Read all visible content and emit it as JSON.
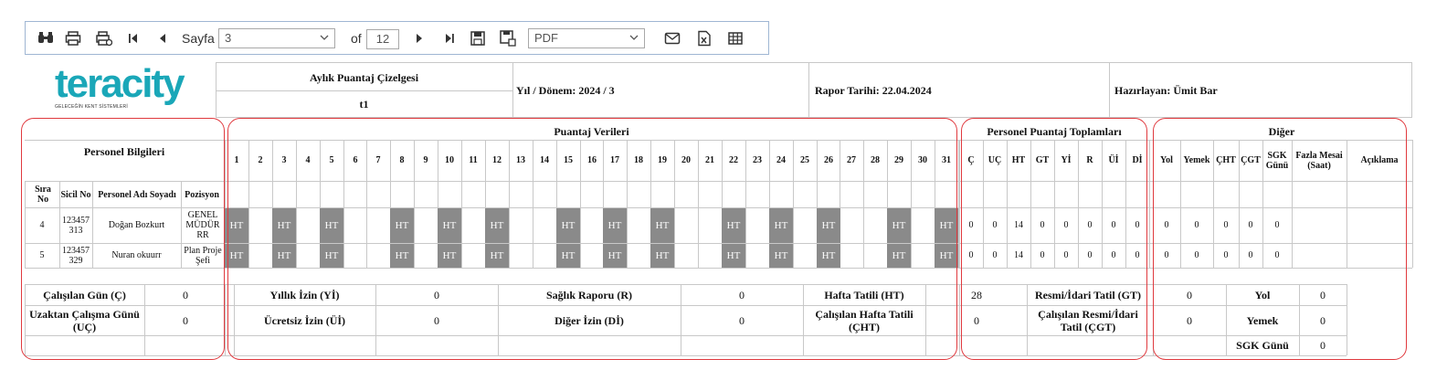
{
  "toolbar": {
    "page_label": "Sayfa",
    "page_value": "3",
    "of_label": "of",
    "page_count": "12",
    "format_value": "PDF"
  },
  "brand": {
    "logo_text": "teracity",
    "logo_subtext": "GELECEĞİN KENT SİSTEMLERİ",
    "color": "#1aa7b8"
  },
  "header": {
    "title": "Aylık Puantaj Çizelgesi",
    "subtitle": "t1",
    "period": "Yıl / Dönem: 2024 / 3",
    "report_date": "Rapor Tarihi: 22.04.2024",
    "prepared_by": "Hazırlayan: Ümit Bar"
  },
  "sections": {
    "personnel": "Personel Bilgileri",
    "attendance": "Puantaj  Verileri",
    "totals": "Personel Puantaj Toplamları",
    "other": "Diğer"
  },
  "personnel_columns": [
    "Sıra No",
    "Sicil No",
    "Personel Adı Soyadı",
    "Pozisyon"
  ],
  "days": [
    "1",
    "2",
    "3",
    "4",
    "5",
    "6",
    "7",
    "8",
    "9",
    "10",
    "11",
    "12",
    "13",
    "14",
    "15",
    "16",
    "17",
    "18",
    "19",
    "20",
    "21",
    "22",
    "23",
    "24",
    "25",
    "26",
    "27",
    "28",
    "29",
    "30",
    "31"
  ],
  "total_columns": [
    "Ç",
    "UÇ",
    "HT",
    "GT",
    "Yİ",
    "R",
    "Üİ",
    "Dİ"
  ],
  "other_columns": [
    "Yol",
    "Yemek",
    "ÇHT",
    "ÇGT",
    "SGK Günü",
    "Fazla Mesai (Saat)",
    "Açıklama"
  ],
  "rows": [
    {
      "sira": "4",
      "sicil": "123457 313",
      "name": "Doğan Bozkurt",
      "position": "GENEL MÜDÜR RR",
      "ht_days": [
        "1",
        "3",
        "5",
        "8",
        "10",
        "12",
        "15",
        "17",
        "19",
        "22",
        "24",
        "26",
        "29",
        "31"
      ],
      "totals": [
        "0",
        "0",
        "14",
        "0",
        "0",
        "0",
        "0",
        "0"
      ],
      "other": [
        "0",
        "0",
        "0",
        "0",
        "0",
        "",
        ""
      ]
    },
    {
      "sira": "5",
      "sicil": "123457 329",
      "name": "Nuran okuurr",
      "position": "Plan Proje Şefi",
      "ht_days": [
        "1",
        "3",
        "5",
        "8",
        "10",
        "12",
        "15",
        "17",
        "19",
        "22",
        "24",
        "26",
        "29",
        "31"
      ],
      "totals": [
        "0",
        "0",
        "14",
        "0",
        "0",
        "0",
        "0",
        "0"
      ],
      "other": [
        "0",
        "0",
        "0",
        "0",
        "0",
        "",
        ""
      ]
    }
  ],
  "ht_label": "HT",
  "legend": {
    "calisilan_gun": "Çalışılan Gün (Ç)",
    "calisilan_gun_val": "0",
    "uzaktan": "Uzaktan Çalışma Günü (UÇ)",
    "uzaktan_val": "0",
    "yillik": "Yıllık İzin (Yİ)",
    "yillik_val": "0",
    "ucretsiz": "Ücretsiz İzin (Üİ)",
    "ucretsiz_val": "0",
    "saglik": "Sağlık Raporu (R)",
    "saglik_val": "0",
    "diger": "Diğer İzin (Dİ)",
    "diger_val": "0",
    "hafta": "Hafta Tatili (HT)",
    "hafta_val": "28",
    "cht": "Çalışılan Hafta Tatili (ÇHT)",
    "cht_val": "0",
    "resmi": "Resmi/İdari Tatil (GT)",
    "resmi_val": "0",
    "cgt": "Çalışılan Resmi/İdari Tatil (ÇGT)",
    "cgt_val": "0",
    "yol": "Yol",
    "yol_val": "0",
    "yemek": "Yemek",
    "yemek_val": "0",
    "sgk": "SGK Günü",
    "sgk_val": "0"
  }
}
